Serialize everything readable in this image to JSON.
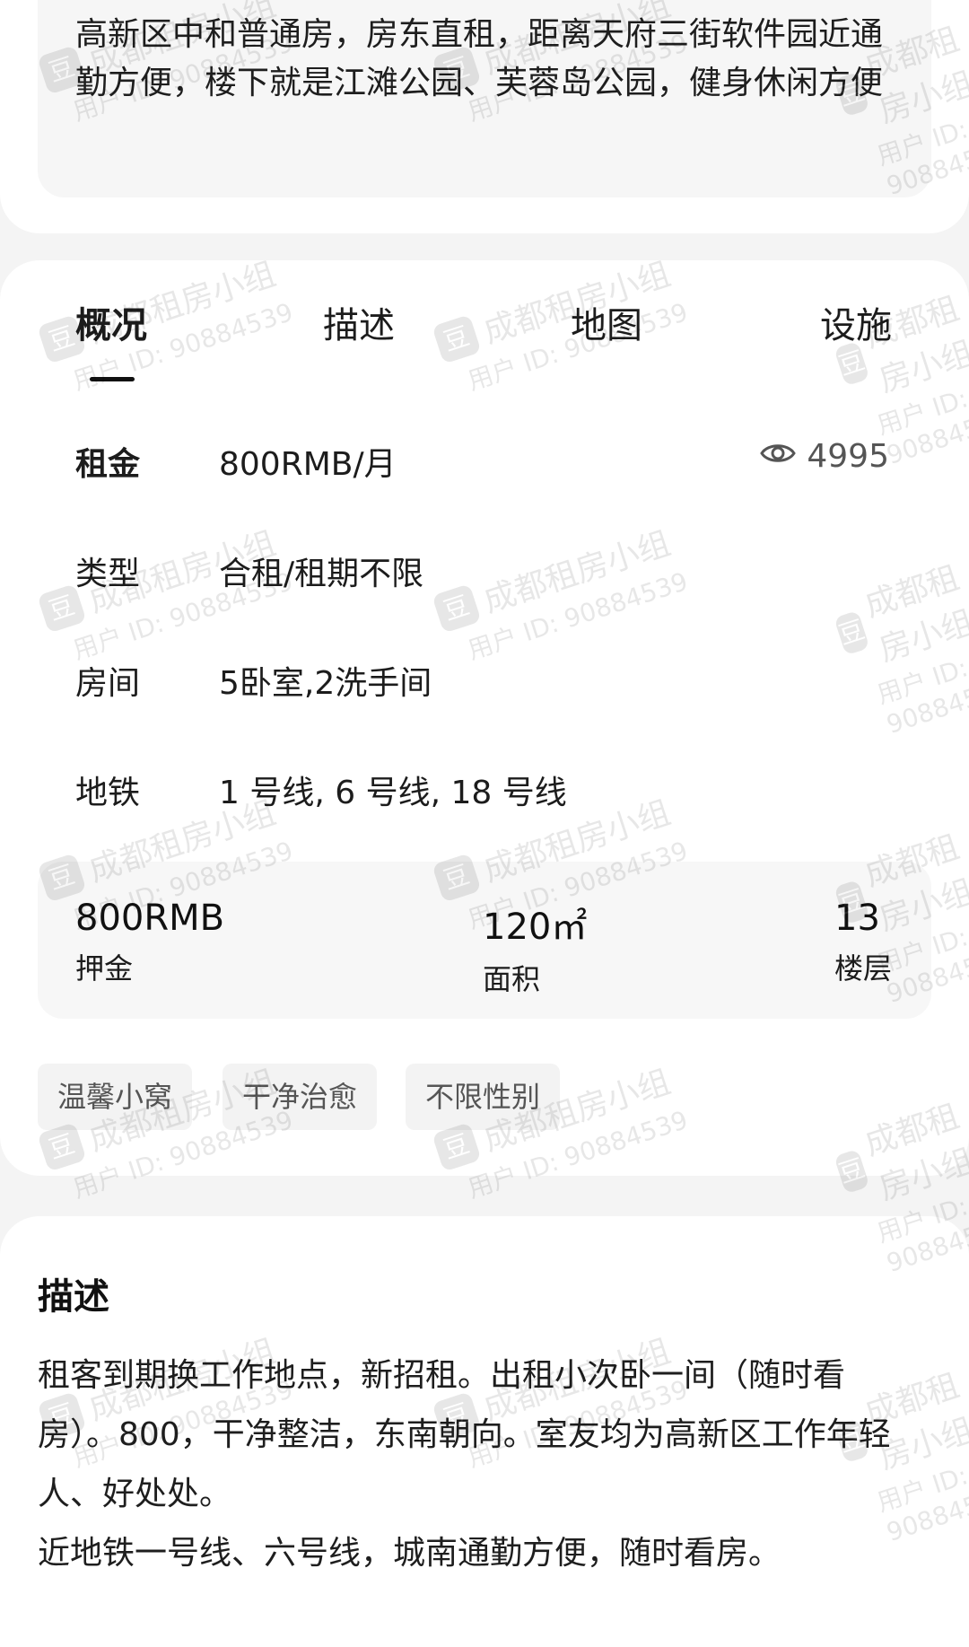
{
  "summary": {
    "text": "高新区中和普通房，房东直租，距离天府三街软件园近通勤方便，楼下就是江滩公园、芙蓉岛公园，健身休闲方便"
  },
  "tabs": [
    {
      "label": "概况",
      "active": true
    },
    {
      "label": "描述",
      "active": false
    },
    {
      "label": "地图",
      "active": false
    },
    {
      "label": "设施",
      "active": false
    }
  ],
  "overview": {
    "rent_label": "租金",
    "rent_value": "800RMB/月",
    "views_icon": "eye-icon",
    "views_count": "4995",
    "type_label": "类型",
    "type_value": "合租/租期不限",
    "room_label": "房间",
    "room_value": "5卧室,2洗手间",
    "metro_label": "地铁",
    "metro_value": "1 号线, 6 号线, 18 号线"
  },
  "stats": [
    {
      "value": "800RMB",
      "caption": "押金"
    },
    {
      "value": "120㎡",
      "caption": "面积"
    },
    {
      "value": "13",
      "caption": "楼层"
    }
  ],
  "tags": [
    "温馨小窝",
    "干净治愈",
    "不限性别"
  ],
  "description": {
    "title": "描述",
    "body": "租客到期换工作地点，新招租。出租小次卧一间（随时看房）。800，干净整洁，东南朝向。室友均为高新区工作年轻人、好处处。\n近地铁一号线、六号线，城南通勤方便，随时看房。"
  },
  "watermark": {
    "logo": "豆",
    "group": "成都租房小组",
    "user": "用户 ID: 90884539"
  }
}
